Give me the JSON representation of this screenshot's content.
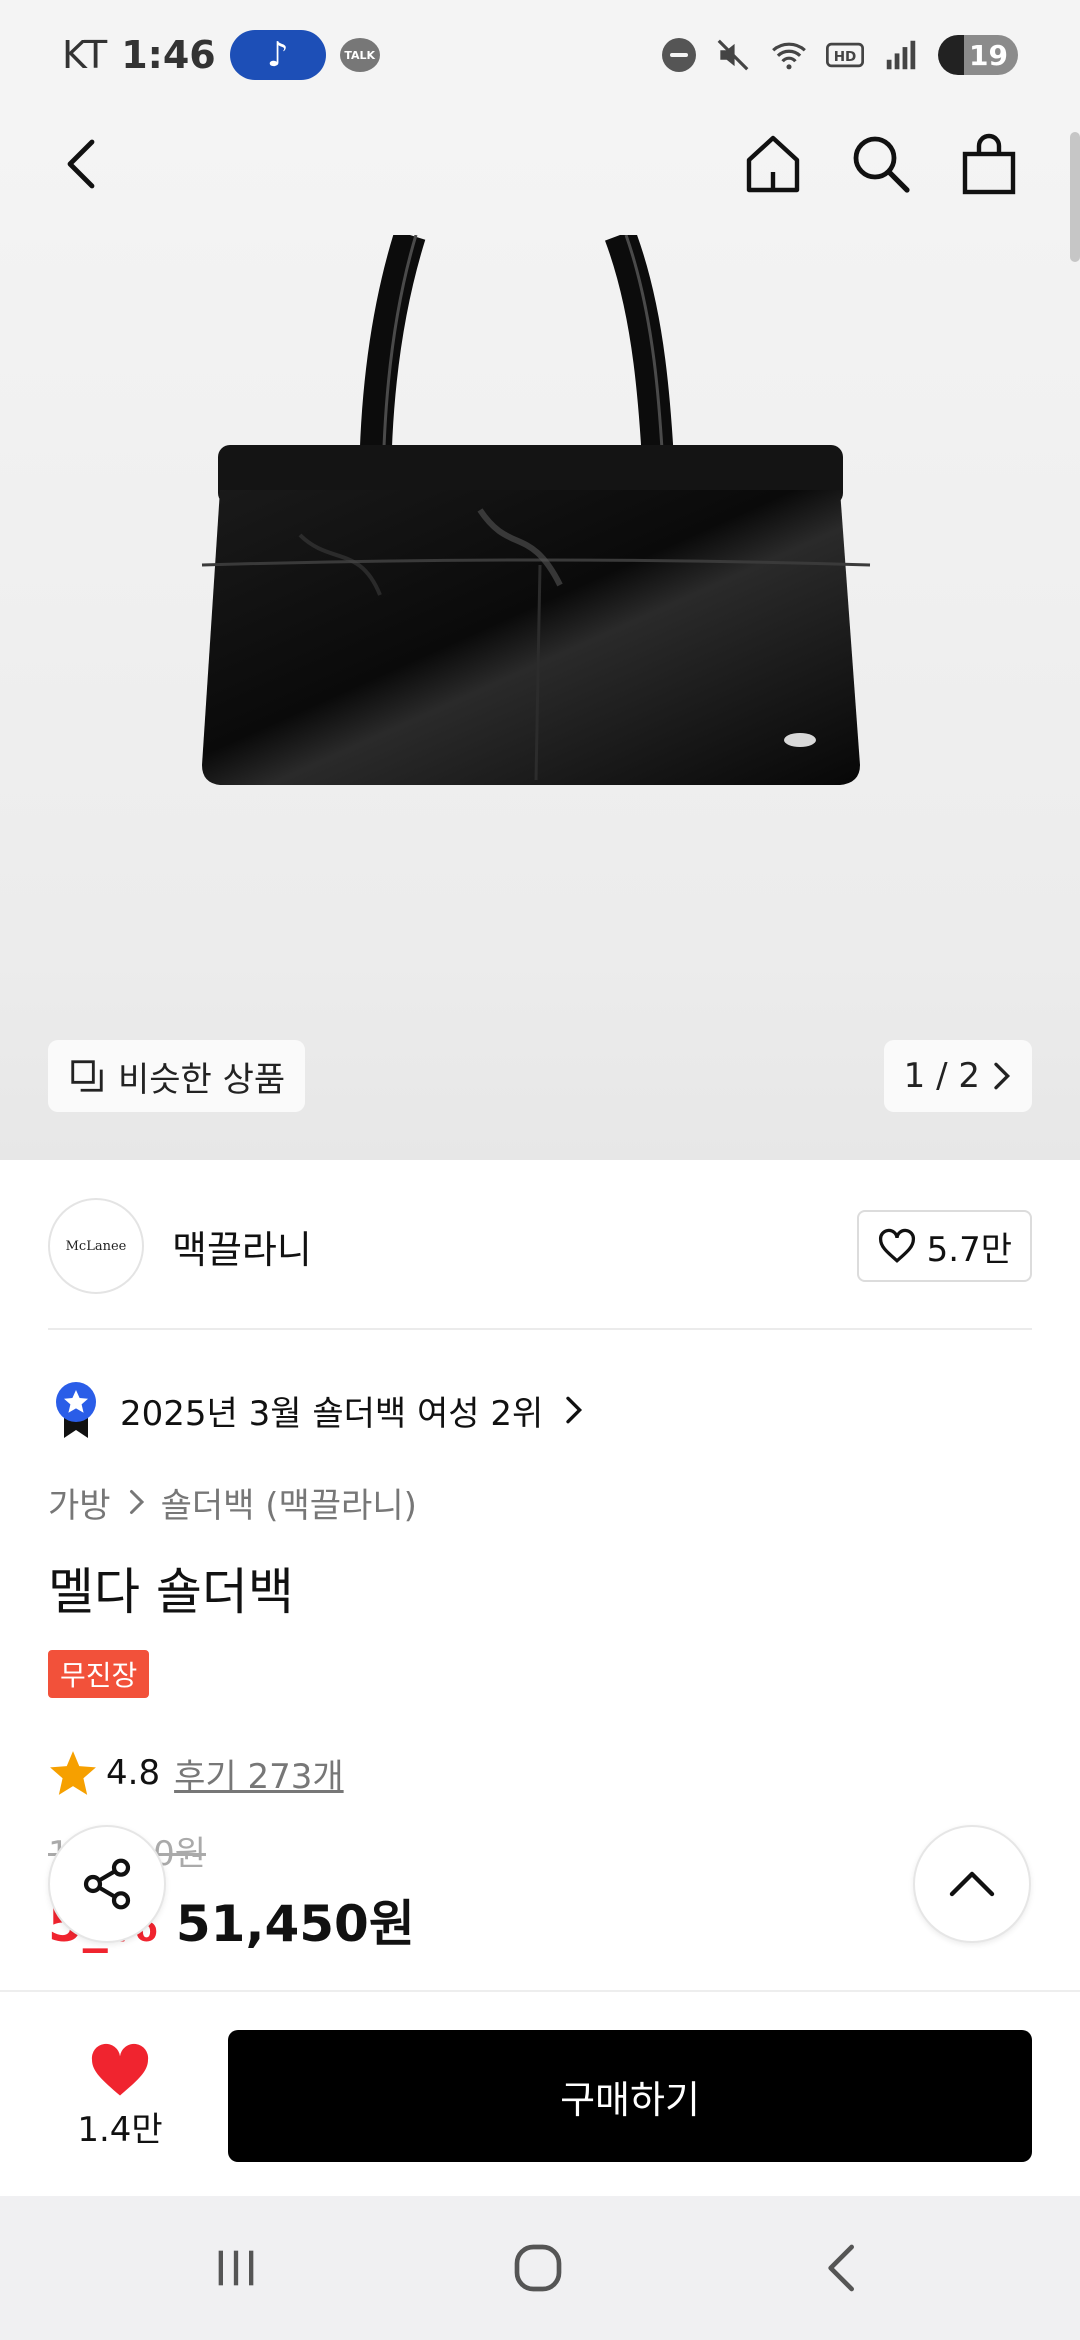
{
  "status_bar": {
    "carrier": "KT",
    "time": "1:46",
    "talk_label": "TALK",
    "battery": "19"
  },
  "gallery": {
    "similar_label": "비슷한 상품",
    "page_indicator": "1 / 2"
  },
  "brand": {
    "logo_text": "McLanee",
    "name": "맥끌라니",
    "likes": "5.7만"
  },
  "ranking": {
    "text": "2025년 3월 숄더백 여성 2위"
  },
  "breadcrumb": {
    "category": "가방",
    "subcategory": "숄더백 (맥끌라니)"
  },
  "product": {
    "name": "멜다 숄더백",
    "badge": "무진장",
    "rating": "4.8",
    "reviews": "후기 273개",
    "original_price": "1__,_00원",
    "discount": "5_%",
    "price": "51,450원"
  },
  "purchase_bar": {
    "like_count": "1.4만",
    "buy_label": "구매하기"
  },
  "colors": {
    "accent_red": "#f0242f",
    "badge_red": "#f2513a",
    "button_black": "#000000"
  }
}
